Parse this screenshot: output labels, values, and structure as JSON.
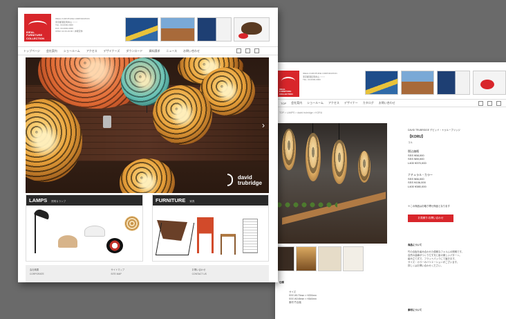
{
  "front_page": {
    "logo": {
      "text": "IDEAL\nFURNITURE\nCOLLECTION"
    },
    "address": "IDEAL FURNITURE CORPORATION\n東京都港区南青山 ○○○○\nTEL. 03-0000-0000\nFAX. 03-0000-0000\nOPEN 11:00-19:00 / 水曜定休",
    "nav_items": [
      "トップページ",
      "会社案内",
      "ショールーム",
      "アクセス",
      "デザイナーズ",
      "ダウンロード",
      "資料請求",
      "ニュース",
      "お問い合わせ"
    ],
    "hero_brand": "david\ntrubridge",
    "hero_next_arrow": "›",
    "categories": [
      {
        "title": "LAMPS",
        "subtitle": "照明＆ランプ"
      },
      {
        "title": "FURNITURE",
        "subtitle": "家具"
      }
    ],
    "footer_columns": [
      "会社概要\nCORPORATE",
      "サイトマップ\nSITE MAP",
      "お問い合わせ\nCONTACT US"
    ]
  },
  "back_page": {
    "logo": {
      "text": "IDEAL\nFURNITURE\nCOLLECTION"
    },
    "address": "IDEAL FURNITURE CORPORATION\n東京都港区南青山 ○○○○\nTEL. 03-0000-0000",
    "nav_items": [
      "TOP",
      "会社案内",
      "ショールーム",
      "アクセス",
      "デザイナー",
      "カタログ",
      "お問い合わせ"
    ],
    "breadcrumb": "TOP > LAMPS > david trubridge > KORU",
    "product_header": "DAVID TRUBRIDGE デビッド・トゥルーブリッジ",
    "product_name": "【KORU】",
    "product_sub": "コル",
    "price_block_1": "税込価格\nSSS ¥58,000\nSSS ¥89,000\nL400 ¥370,000",
    "price_block_2": "ナチュラル・カラー\nSSS ¥66,000\nSSS ¥106,000\nL400 ¥380,000",
    "stock_note": "※この商品はお取り寄せ商品となります",
    "cta_label": "お見積り/お問い合わせ",
    "desc_title": "商品について",
    "desc_text": "竹の合板を組み合わせた優雅なフォルムの照明です。\n自然の曲線がつくりだす光と影の美しいパターン。\n組み立て式で、フラットパックにて届きます。\nサイズ・カラーのバリエーションがございます。\n詳しくはお問い合わせください。",
    "spec_title": "仕様",
    "specs": "サイズ\nSSS W170mm × H230mm\nSSS W245mm × H340mm\n素材  竹合板",
    "material_title": "素材について"
  },
  "colors": {
    "brand_red": "#d8262b",
    "bar_dark": "#2a2a2a",
    "background": "#6a6a6a"
  }
}
